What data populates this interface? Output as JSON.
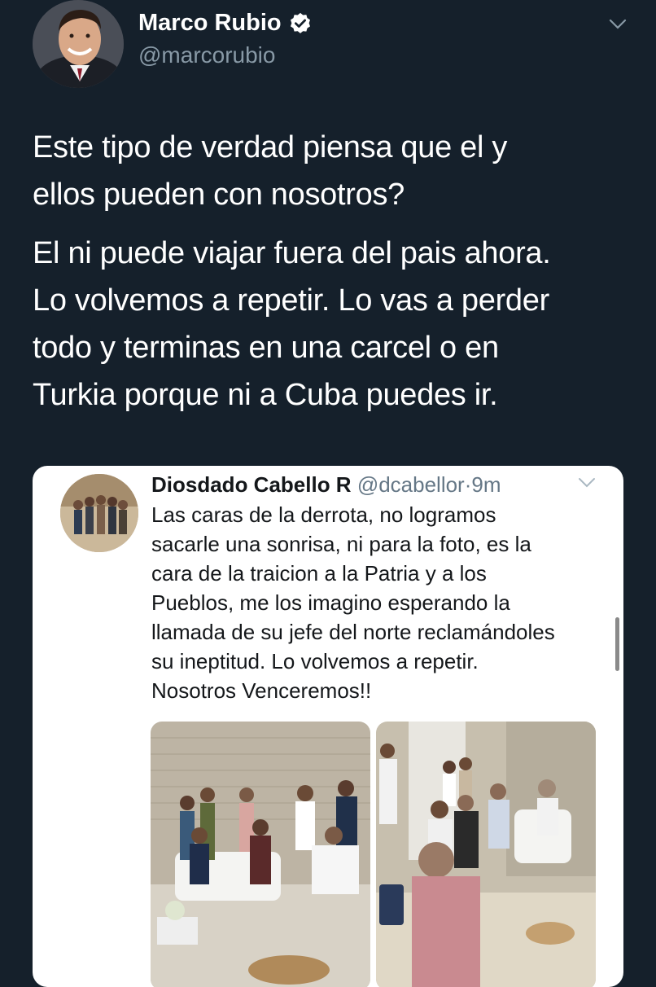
{
  "author": {
    "name": "Marco Rubio",
    "handle": "@marcorubio",
    "verified_icon": "verified-badge-icon",
    "menu_icon": "chevron-down-icon"
  },
  "tweet": {
    "paragraphs": [
      "Este tipo de verdad piensa que el y\nellos pueden con nosotros?",
      "El ni puede viajar fuera del pais ahora.\nLo volvemos a repetir. Lo vas a perder\ntodo y terminas en una carcel o en\nTurkia porque ni a Cuba puedes ir."
    ]
  },
  "quoted": {
    "name": "Diosdado Cabello R",
    "handle": "@dcabellor",
    "separator": "·",
    "time": "9m",
    "text": "Las caras de la derrota, no logramos\nsacarle una sonrisa, ni para la foto, es la\ncara de la traicion a la Patria y a los\nPueblos, me los imagino esperando la\nllamada de su jefe del norte reclamándoles\nsu ineptitud. Lo volvemos a repetir.\nNosotros Venceremos!!",
    "photos": [
      "meeting-photo-left",
      "meeting-photo-right"
    ]
  },
  "colors": {
    "background": "#15202b",
    "text_primary": "#ffffff",
    "text_secondary": "#8899a6",
    "card_background": "#ffffff",
    "card_text": "#14171a",
    "card_secondary": "#657786"
  }
}
